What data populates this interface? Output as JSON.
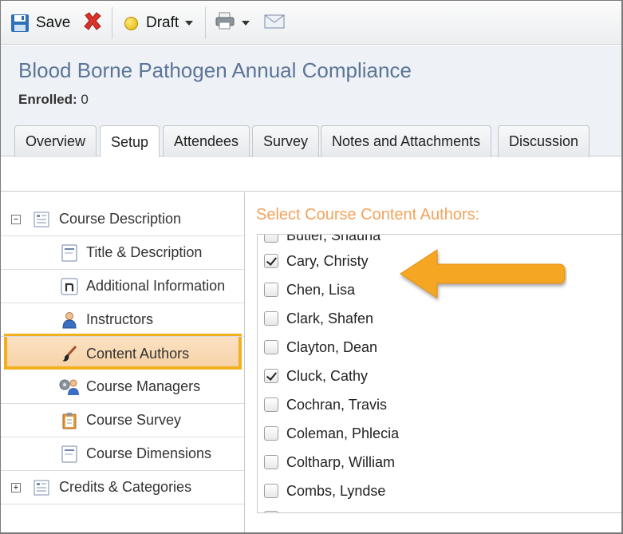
{
  "toolbar": {
    "save_label": "Save",
    "status_label": "Draft",
    "icons": [
      "save-icon",
      "delete-icon",
      "status-dot-icon",
      "print-icon",
      "email-icon"
    ]
  },
  "header": {
    "title": "Blood Borne Pathogen Annual Compliance",
    "enrolled_label": "Enrolled:",
    "enrolled_value": "0"
  },
  "tabs": [
    {
      "label": "Overview",
      "active": false
    },
    {
      "label": "Setup",
      "active": true
    },
    {
      "label": "Attendees",
      "active": false
    },
    {
      "label": "Survey",
      "active": false
    },
    {
      "label": "Notes and Attachments",
      "active": false
    },
    {
      "label": "Discussion",
      "active": false
    }
  ],
  "tree": [
    {
      "label": "Course Description",
      "expander": "−",
      "icon": "form-icon",
      "level": 0
    },
    {
      "label": "Title & Description",
      "icon": "document-icon",
      "level": 1
    },
    {
      "label": "Additional Information",
      "icon": "info-n-icon",
      "level": 1
    },
    {
      "label": "Instructors",
      "icon": "person-icon",
      "level": 1
    },
    {
      "label": "Content Authors",
      "icon": "brush-icon",
      "level": 1,
      "selected": true
    },
    {
      "label": "Course Managers",
      "icon": "managers-icon",
      "level": 1
    },
    {
      "label": "Course Survey",
      "icon": "clipboard-icon",
      "level": 1
    },
    {
      "label": "Course Dimensions",
      "icon": "document-icon",
      "level": 1
    },
    {
      "label": "Credits & Categories",
      "expander": "+",
      "icon": "form-icon",
      "level": 0
    }
  ],
  "authors_panel": {
    "title": "Select Course Content Authors:",
    "items": [
      {
        "name": "Butler, Shauna",
        "checked": false
      },
      {
        "name": "Cary, Christy",
        "checked": true
      },
      {
        "name": "Chen, Lisa",
        "checked": false
      },
      {
        "name": "Clark, Shafen",
        "checked": false
      },
      {
        "name": "Clayton, Dean",
        "checked": false
      },
      {
        "name": "Cluck, Cathy",
        "checked": true
      },
      {
        "name": "Cochran, Travis",
        "checked": false
      },
      {
        "name": "Coleman, Phlecia",
        "checked": false
      },
      {
        "name": "Coltharp, William",
        "checked": false
      },
      {
        "name": "Combs, Lyndse",
        "checked": false
      },
      {
        "name": "",
        "checked": false
      }
    ]
  },
  "colors": {
    "title_blue": "#5b7598",
    "panel_title_orange": "#f4a35b",
    "highlight_border": "#f2b01e",
    "arrow": "#f5a623"
  }
}
